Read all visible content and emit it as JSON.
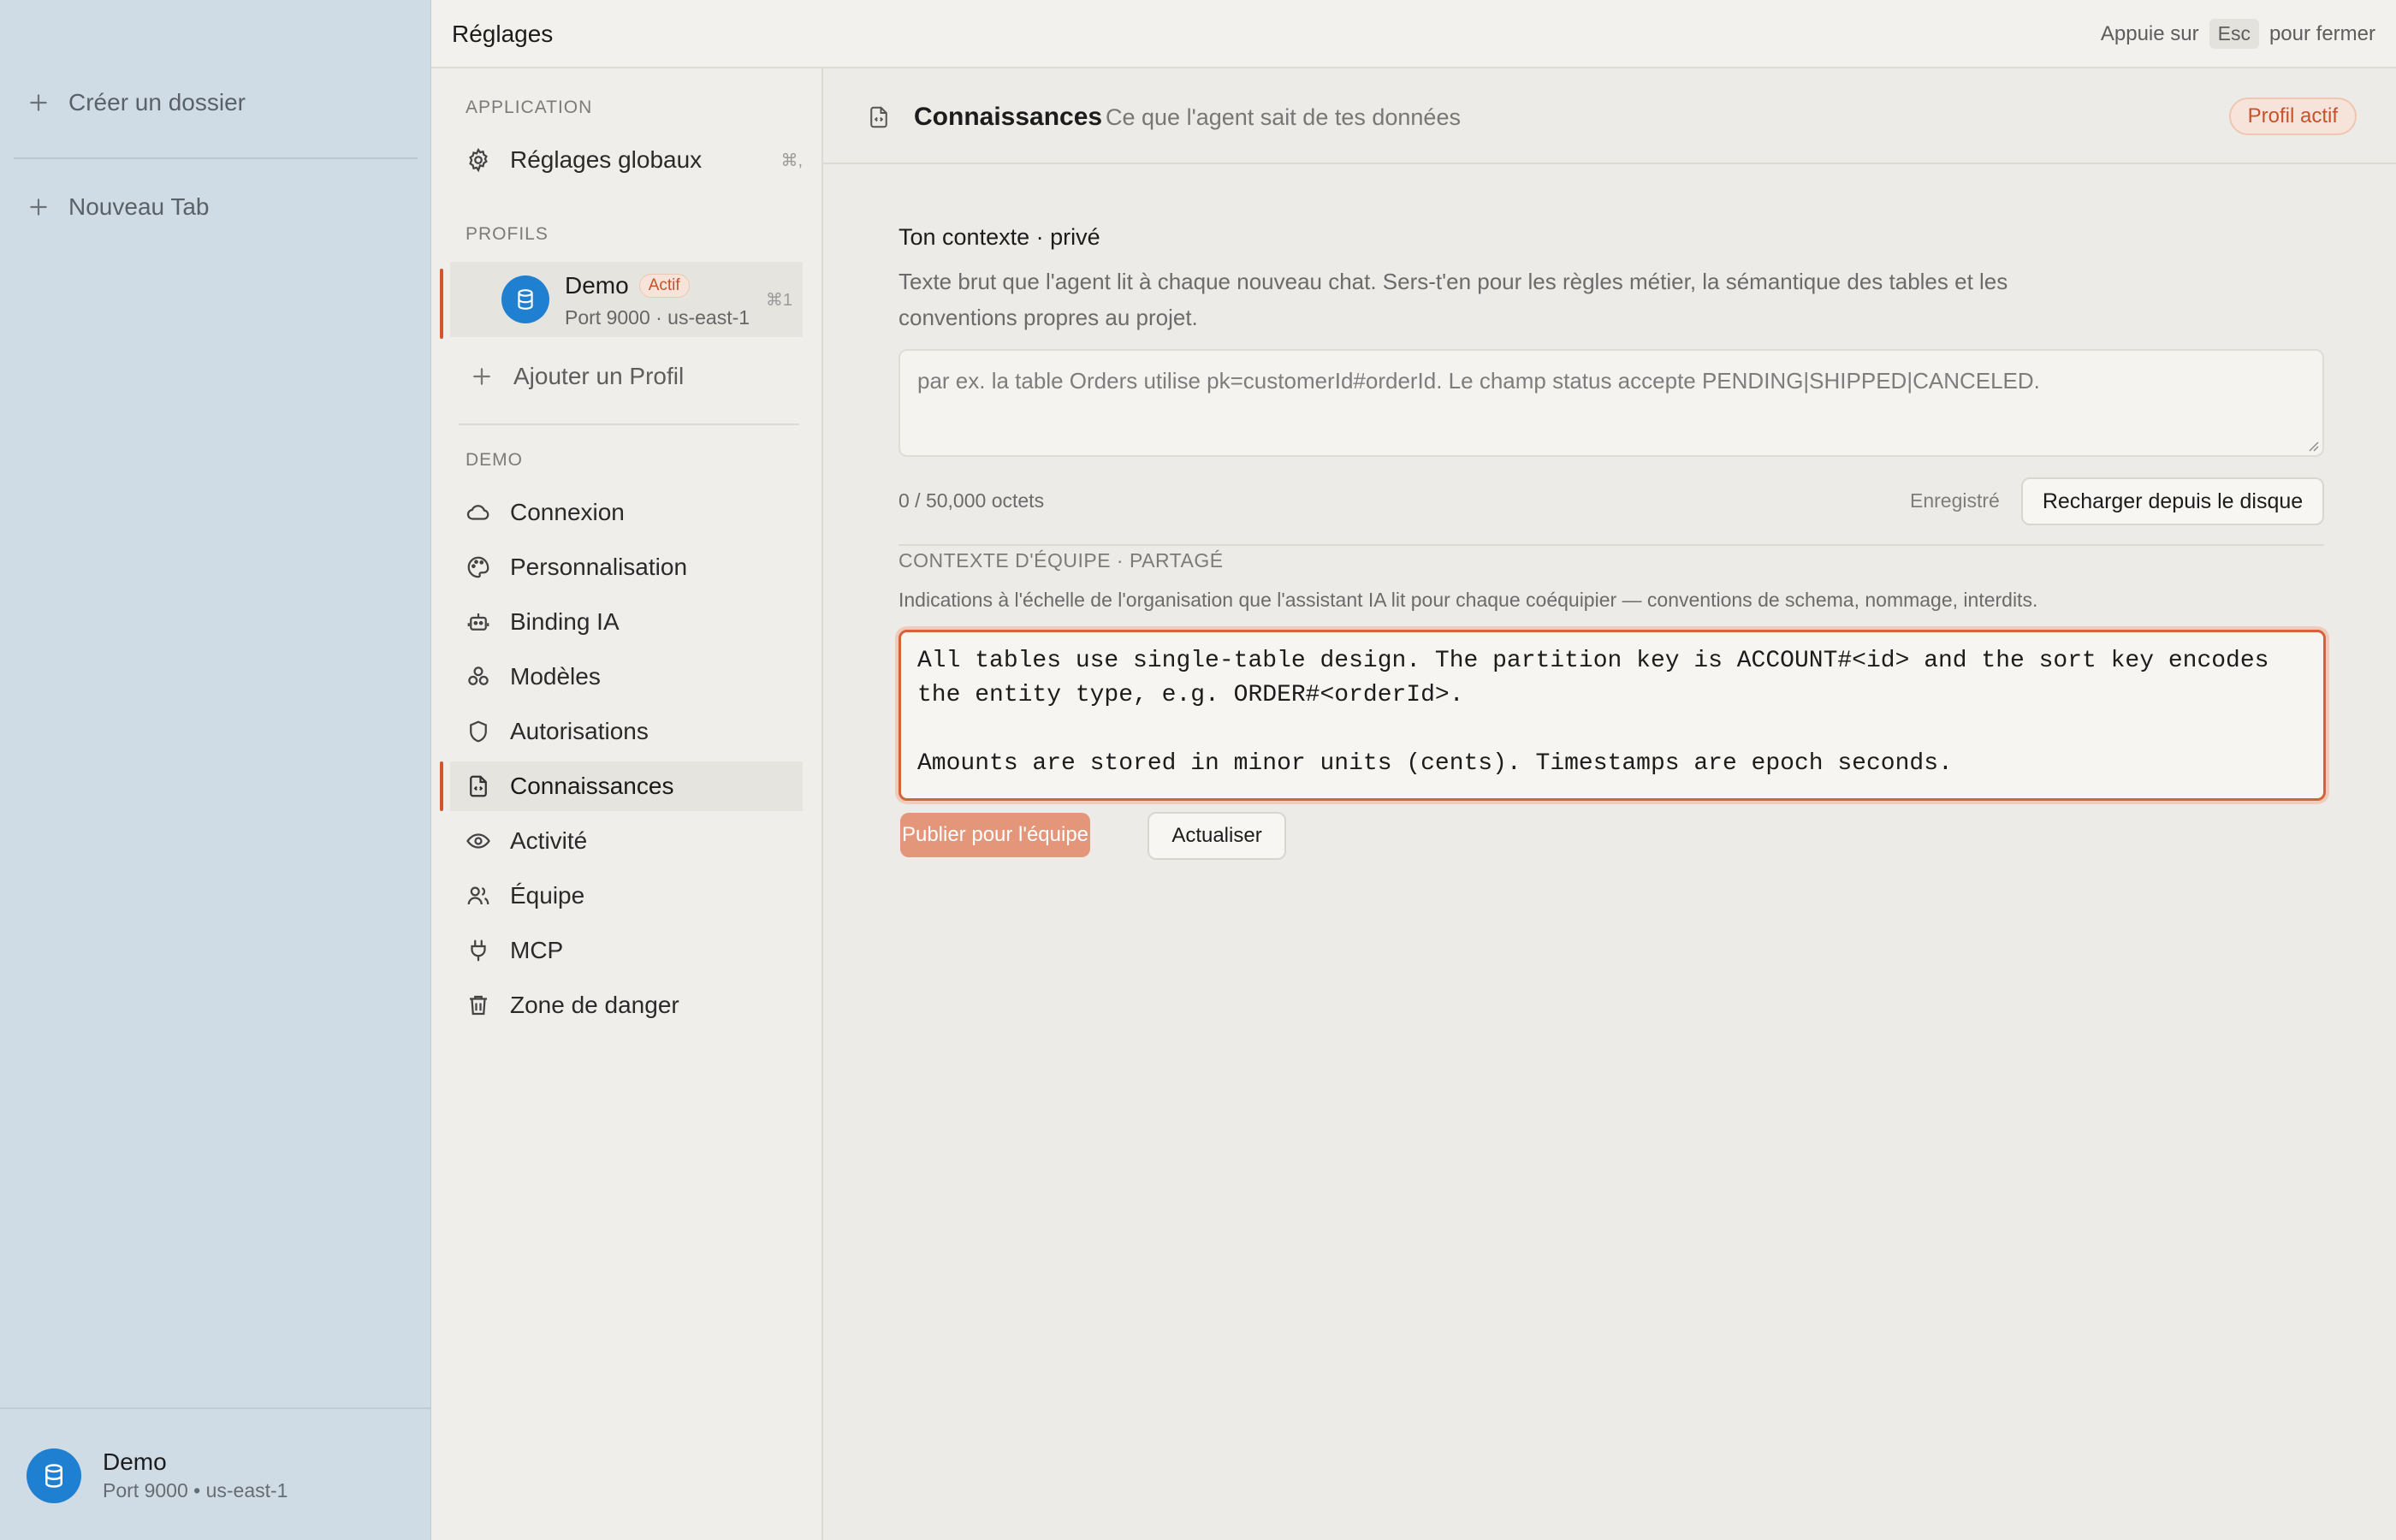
{
  "app_sidebar": {
    "actions": [
      {
        "label": "Créer un dossier",
        "icon": "plus-icon"
      },
      {
        "label": "Nouveau Tab",
        "icon": "plus-icon"
      }
    ],
    "connection": {
      "name": "Demo",
      "subtitle": "Port 9000 • us-east-1",
      "icon": "database-icon"
    }
  },
  "topbar": {
    "title": "Réglages",
    "hint_prefix": "Appuie sur",
    "hint_key": "Esc",
    "hint_suffix": "pour fermer"
  },
  "nav": {
    "section_application": "APPLICATION",
    "global_settings": {
      "label": "Réglages globaux",
      "shortcut": "⌘,",
      "icon": "gear-icon"
    },
    "section_profiles": "PROFILS",
    "profile": {
      "name": "Demo",
      "badge": "Actif",
      "subtitle": "Port 9000 · us-east-1",
      "shortcut": "⌘1"
    },
    "add_profile": "Ajouter un Profil",
    "section_demo": "DEMO",
    "items": [
      {
        "label": "Connexion",
        "icon": "cloud-icon"
      },
      {
        "label": "Personnalisation",
        "icon": "palette-icon"
      },
      {
        "label": "Binding IA",
        "icon": "robot-icon"
      },
      {
        "label": "Modèles",
        "icon": "models-icon"
      },
      {
        "label": "Autorisations",
        "icon": "shield-icon"
      },
      {
        "label": "Connaissances",
        "icon": "document-code-icon",
        "active": true
      },
      {
        "label": "Activité",
        "icon": "eye-icon"
      },
      {
        "label": "Équipe",
        "icon": "users-icon"
      },
      {
        "label": "MCP",
        "icon": "plug-icon"
      },
      {
        "label": "Zone de danger",
        "icon": "trash-icon"
      }
    ]
  },
  "main": {
    "header": {
      "title": "Connaissances",
      "subtitle": "Ce que l'agent sait de tes données",
      "badge": "Profil actif"
    },
    "private": {
      "title": "Ton contexte · privé",
      "description": "Texte brut que l'agent lit à chaque nouveau chat. Sers-t'en pour les règles métier, la sémantique des tables et les conventions propres au projet.",
      "placeholder": "par ex. la table Orders utilise pk=customerId#orderId. Le champ status accepte PENDING|SHIPPED|CANCELED.",
      "value": "",
      "counter": "0 / 50,000 octets",
      "status": "Enregistré",
      "reload_button": "Recharger depuis le disque"
    },
    "team": {
      "title": "CONTEXTE D'ÉQUIPE · PARTAGÉ",
      "description": "Indications à l'échelle de l'organisation que l'assistant IA lit pour chaque coéquipier — conventions de schema, nommage, interdits.",
      "value": "All tables use single-table design. The partition key is ACCOUNT#<id> and the sort key encodes\nthe entity type, e.g. ORDER#<orderId>.\n\nAmounts are stored in minor units (cents). Timestamps are epoch seconds.",
      "publish_button": "Publier pour l'équipe",
      "refresh_button": "Actualiser"
    }
  },
  "colors": {
    "accent": "#d5542a",
    "db_avatar": "#1f7fd1",
    "sidebar_bg": "#d0dce5"
  }
}
